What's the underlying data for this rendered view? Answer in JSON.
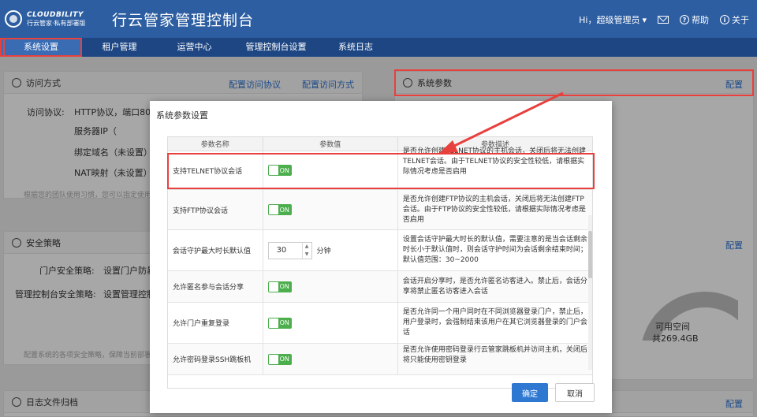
{
  "header": {
    "logo_en": "CLOUDBILITY",
    "logo_cn": "行云管家·私有部署版",
    "title": "行云管家管理控制台",
    "user": "Hi，超级管理员",
    "help": "帮助",
    "about": "关于"
  },
  "nav": {
    "items": [
      {
        "label": "系统设置"
      },
      {
        "label": "租户管理"
      },
      {
        "label": "运营中心"
      },
      {
        "label": "管理控制台设置"
      },
      {
        "label": "系统日志"
      }
    ]
  },
  "panels": {
    "access": {
      "title": "访问方式",
      "link1": "配置访问协议",
      "link2": "配置访问方式",
      "protocol_label": "访问协议:",
      "protocol_value": "HTTP协议，端口80",
      "server_ip": "服务器IP（",
      "domain": "绑定域名（未设置）",
      "nat": "NAT映射（未设置）",
      "hint": "根据您的团队使用习惯，您可以指定使用"
    },
    "sysparam": {
      "title": "系统参数",
      "link": "配置"
    },
    "security": {
      "title": "安全策略",
      "link": "配置",
      "portal_label": "门户安全策略:",
      "portal_value": "设置门户防暴",
      "console_label": "管理控制台安全策略:",
      "console_value": "设置管理控制",
      "hint": "配置系统的各项安全策略，保障当前部署"
    },
    "storage": {
      "free_label": "可用空间",
      "total": "共269.4GB"
    },
    "logs": {
      "title": "日志文件归档",
      "link": "配置"
    }
  },
  "modal": {
    "title": "系统参数设置",
    "columns": [
      "参数名称",
      "参数值",
      "参数描述"
    ],
    "rows": [
      {
        "name": "支持TELNET协议会话",
        "toggle": "ON",
        "desc": "是否允许创建TELNET协议的主机会话，关闭后将无法创建TELNET会话。由于TELNET协议的安全性较低，请根据实际情况考虑是否启用"
      },
      {
        "name": "支持FTP协议会话",
        "toggle": "ON",
        "desc": "是否允许创建FTP协议的主机会话，关闭后将无法创建FTP会话。由于FTP协议的安全性较低，请根据实际情况考虑是否启用"
      },
      {
        "name": "会话守护最大时长默认值",
        "value": "30",
        "unit": "分钟",
        "desc": "设置会话守护最大时长的默认值，需要注意的是当会话剩余时长小于默认值时，则会话守护时间为会话剩余结束时间；默认值范围：30~2000"
      },
      {
        "name": "允许匿名参与会话分享",
        "toggle": "ON",
        "desc": "会话开启分享时，是否允许匿名访客进入。禁止后，会话分享将禁止匿名访客进入会话"
      },
      {
        "name": "允许门户重复登录",
        "toggle": "ON",
        "desc": "是否允许同一个用户同时在不同浏览器登录门户，禁止后，用户登录时，会强制结束该用户在其它浏览器登录的门户会话"
      },
      {
        "name": "允许密码登录SSH跳板机",
        "toggle": "ON",
        "desc": "是否允许使用密码登录行云管家跳板机并访问主机，关闭后将只能使用密钥登录"
      }
    ],
    "ok": "确定",
    "cancel": "取消"
  }
}
